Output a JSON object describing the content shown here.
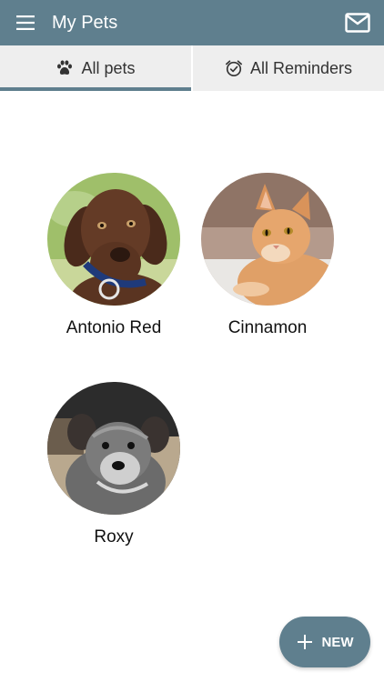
{
  "app": {
    "title": "My Pets",
    "accent_color": "#5f7f8e",
    "menu_icon": "menu-icon",
    "mail_icon": "mail-icon"
  },
  "tabs": [
    {
      "label": "All pets",
      "icon": "paw-icon",
      "selected": true
    },
    {
      "label": "All Reminders",
      "icon": "alarm-check-icon",
      "selected": false
    }
  ],
  "pets": [
    {
      "name": "Antonio Red",
      "photo": "chocolate-labrador-puppy"
    },
    {
      "name": "Cinnamon",
      "photo": "orange-tabby-cat"
    },
    {
      "name": "Roxy",
      "photo": "schnauzer-puppy"
    }
  ],
  "fab": {
    "label": "NEW",
    "icon": "plus-icon"
  }
}
